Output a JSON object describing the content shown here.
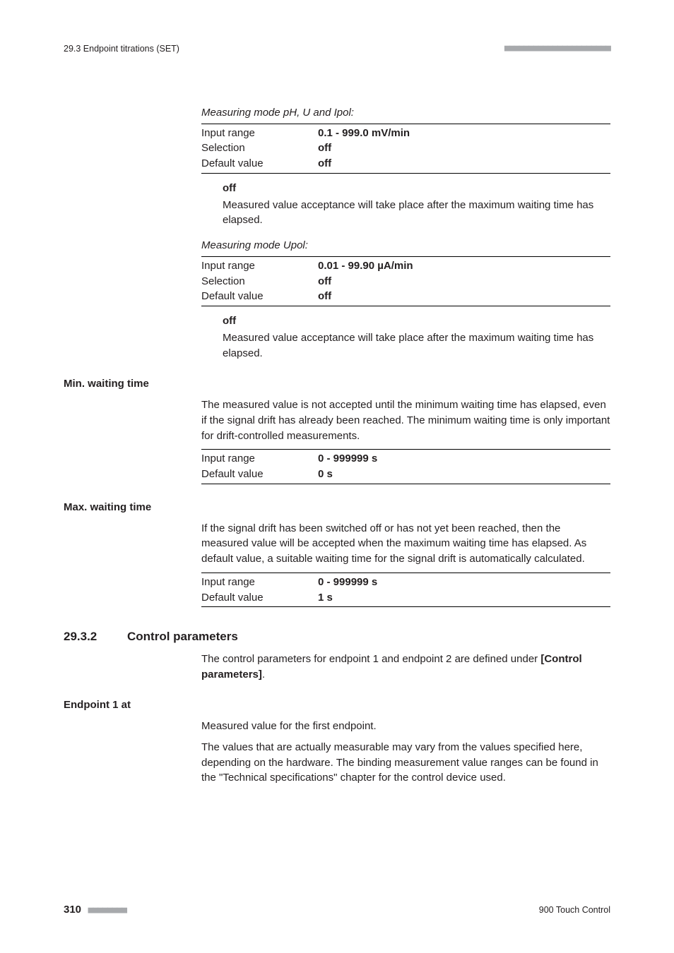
{
  "header": {
    "section_ref": "29.3 Endpoint titrations (SET)",
    "dashes": "■■■■■■■■■■■■■■■■■■■■■■"
  },
  "block1": {
    "mode_label": "Measuring mode pH, U and Ipol:",
    "input_range_label": "Input range",
    "input_range_value": "0.1 - 999.0 mV/min",
    "selection_label": "Selection",
    "selection_value": "off",
    "default_label": "Default value",
    "default_value": "off",
    "term_label": "off",
    "term_desc": "Measured value acceptance will take place after the maximum waiting time has elapsed."
  },
  "block2": {
    "mode_label": "Measuring mode Upol:",
    "input_range_label": "Input range",
    "input_range_value": "0.01 - 99.90 µA/min",
    "selection_label": "Selection",
    "selection_value": "off",
    "default_label": "Default value",
    "default_value": "off",
    "term_label": "off",
    "term_desc": "Measured value acceptance will take place after the maximum waiting time has elapsed."
  },
  "min_wait": {
    "heading": "Min. waiting time",
    "desc": "The measured value is not accepted until the minimum waiting time has elapsed, even if the signal drift has already been reached. The minimum waiting time is only important for drift-controlled measurements.",
    "input_range_label": "Input range",
    "input_range_value": "0 - 999999 s",
    "default_label": "Default value",
    "default_value": "0 s"
  },
  "max_wait": {
    "heading": "Max. waiting time",
    "desc": "If the signal drift has been switched off or has not yet been reached, then the measured value will be accepted when the maximum waiting time has elapsed. As default value, a suitable waiting time for the signal drift is automatically calculated.",
    "input_range_label": "Input range",
    "input_range_value": "0 - 999999 s",
    "default_label": "Default value",
    "default_value": "1 s"
  },
  "section": {
    "num": "29.3.2",
    "title": "Control parameters",
    "intro_a": "The control parameters for endpoint 1 and endpoint 2 are defined under ",
    "intro_b": "[Control parameters]",
    "intro_c": "."
  },
  "endpoint1": {
    "heading": "Endpoint 1 at",
    "p1": "Measured value for the first endpoint.",
    "p2": "The values that are actually measurable may vary from the values specified here, depending on the hardware. The binding measurement value ranges can be found in the \"Technical specifications\" chapter for the control device used."
  },
  "footer": {
    "page": "310",
    "dashes": "■■■■■■■■",
    "product": "900 Touch Control"
  }
}
